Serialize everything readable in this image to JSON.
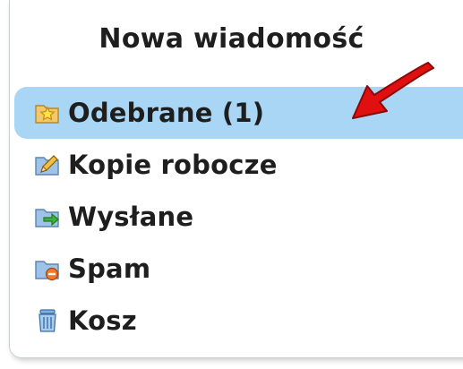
{
  "compose": {
    "label": "Nowa wiadomość"
  },
  "folders": [
    {
      "label": "Odebrane (1)",
      "icon": "inbox-star-folder-icon",
      "active": true
    },
    {
      "label": "Kopie robocze",
      "icon": "drafts-pencil-icon",
      "active": false
    },
    {
      "label": "Wysłane",
      "icon": "sent-folder-icon",
      "active": false
    },
    {
      "label": "Spam",
      "icon": "spam-folder-icon",
      "active": false
    },
    {
      "label": "Kosz",
      "icon": "trash-bin-icon",
      "active": false
    }
  ],
  "colors": {
    "active_row": "#a9d6f5",
    "annotation_arrow": "#e01010",
    "text": "#1e1e1e"
  }
}
